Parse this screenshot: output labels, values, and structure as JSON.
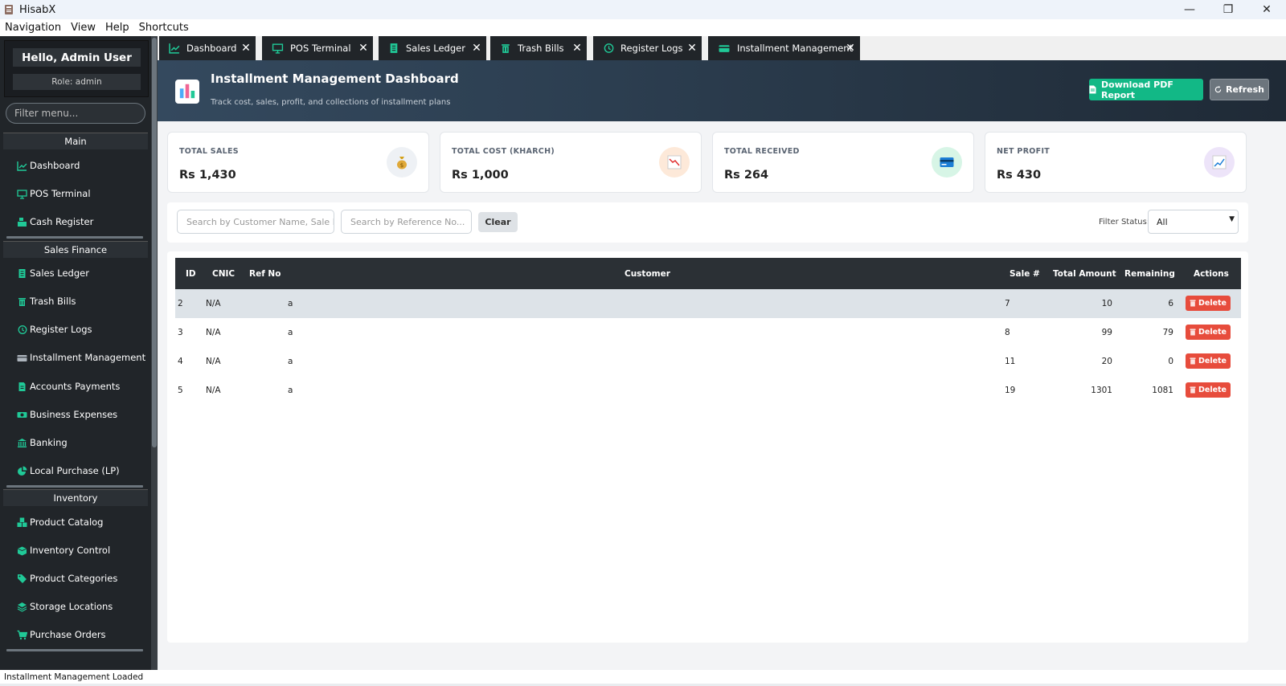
{
  "window": {
    "title": "HisabX",
    "controls": {
      "minimize": "—",
      "maximize": "❐",
      "close": "✕"
    }
  },
  "menubar": [
    "Navigation",
    "View",
    "Help",
    "Shortcuts"
  ],
  "sidebar": {
    "greeting": "Hello, Admin User",
    "role": "Role: admin",
    "filter_placeholder": "Filter menu...",
    "sections": [
      {
        "title": "Main",
        "items": [
          {
            "label": "Dashboard",
            "icon": "chart-line-icon"
          },
          {
            "label": "POS Terminal",
            "icon": "monitor-icon"
          },
          {
            "label": "Cash Register",
            "icon": "cash-register-icon"
          }
        ]
      },
      {
        "title": "Sales  Finance",
        "items": [
          {
            "label": "Sales Ledger",
            "icon": "receipt-icon"
          },
          {
            "label": "Trash Bills",
            "icon": "trash-icon"
          },
          {
            "label": "Register Logs",
            "icon": "history-icon"
          },
          {
            "label": "Installment Management",
            "icon": "credit-card-icon"
          },
          {
            "label": "Accounts  Payments",
            "icon": "file-invoice-icon"
          },
          {
            "label": "Business Expenses",
            "icon": "money-icon"
          },
          {
            "label": "Banking",
            "icon": "bank-icon"
          },
          {
            "label": "Local Purchase (LP)",
            "icon": "pie-chart-icon"
          }
        ]
      },
      {
        "title": "Inventory",
        "items": [
          {
            "label": "Product Catalog",
            "icon": "boxes-icon"
          },
          {
            "label": "Inventory Control",
            "icon": "box-open-icon"
          },
          {
            "label": "Product Categories",
            "icon": "tags-icon"
          },
          {
            "label": "Storage Locations",
            "icon": "layers-icon"
          },
          {
            "label": "Purchase Orders",
            "icon": "cart-icon"
          }
        ]
      }
    ]
  },
  "tabs": [
    {
      "label": "Dashboard",
      "icon": "chart-line-icon"
    },
    {
      "label": "POS Terminal",
      "icon": "monitor-icon"
    },
    {
      "label": "Sales Ledger",
      "icon": "receipt-icon"
    },
    {
      "label": "Trash Bills",
      "icon": "trash-icon"
    },
    {
      "label": "Register Logs",
      "icon": "history-icon"
    },
    {
      "label": "Installment Management",
      "icon": "credit-card-icon",
      "active": true
    }
  ],
  "tab_close": "✕",
  "header": {
    "title": "Installment Management Dashboard",
    "subtitle": "Track cost, sales, profit, and collections of installment plans",
    "pdf_button": "Download PDF Report",
    "refresh_button": "Refresh"
  },
  "cards": [
    {
      "label": "TOTAL SALES",
      "value": "Rs 1,430",
      "icon": "money-bag-icon",
      "bg": "#eef1f5"
    },
    {
      "label": "TOTAL COST (KHARCH)",
      "value": "Rs 1,000",
      "icon": "chart-down-icon",
      "bg": "#fde9d9"
    },
    {
      "label": "TOTAL RECEIVED",
      "value": "Rs 264",
      "icon": "credit-card-icon",
      "bg": "#d7f5e6"
    },
    {
      "label": "NET PROFIT",
      "value": "Rs 430",
      "icon": "chart-up-icon",
      "bg": "#ede4f9"
    }
  ],
  "filters": {
    "customer_placeholder": "Search by Customer Name, Sale I...",
    "reference_placeholder": "Search by Reference No...",
    "clear_button": "Clear",
    "status_label": "Filter Status:",
    "status_value": "All"
  },
  "table": {
    "columns": [
      "ID",
      "CNIC",
      "Ref No",
      "Customer",
      "Sale #",
      "Total Amount",
      "Remaining",
      "Actions"
    ],
    "delete_label": "Delete",
    "rows": [
      {
        "id": "2",
        "cnic": "N/A",
        "ref": "",
        "customer": "a",
        "sale": "7",
        "total": "10",
        "remaining": "6",
        "selected": true
      },
      {
        "id": "3",
        "cnic": "N/A",
        "ref": "",
        "customer": "a",
        "sale": "8",
        "total": "99",
        "remaining": "79"
      },
      {
        "id": "4",
        "cnic": "N/A",
        "ref": "",
        "customer": "a",
        "sale": "11",
        "total": "20",
        "remaining": "0"
      },
      {
        "id": "5",
        "cnic": "N/A",
        "ref": "",
        "customer": "a",
        "sale": "19",
        "total": "1301",
        "remaining": "1081"
      }
    ]
  },
  "status": "Installment Management Loaded",
  "colors": {
    "accent": "#12b886",
    "danger": "#e74c3c",
    "sidebar": "#212529",
    "icon_teal": "#20c997"
  }
}
